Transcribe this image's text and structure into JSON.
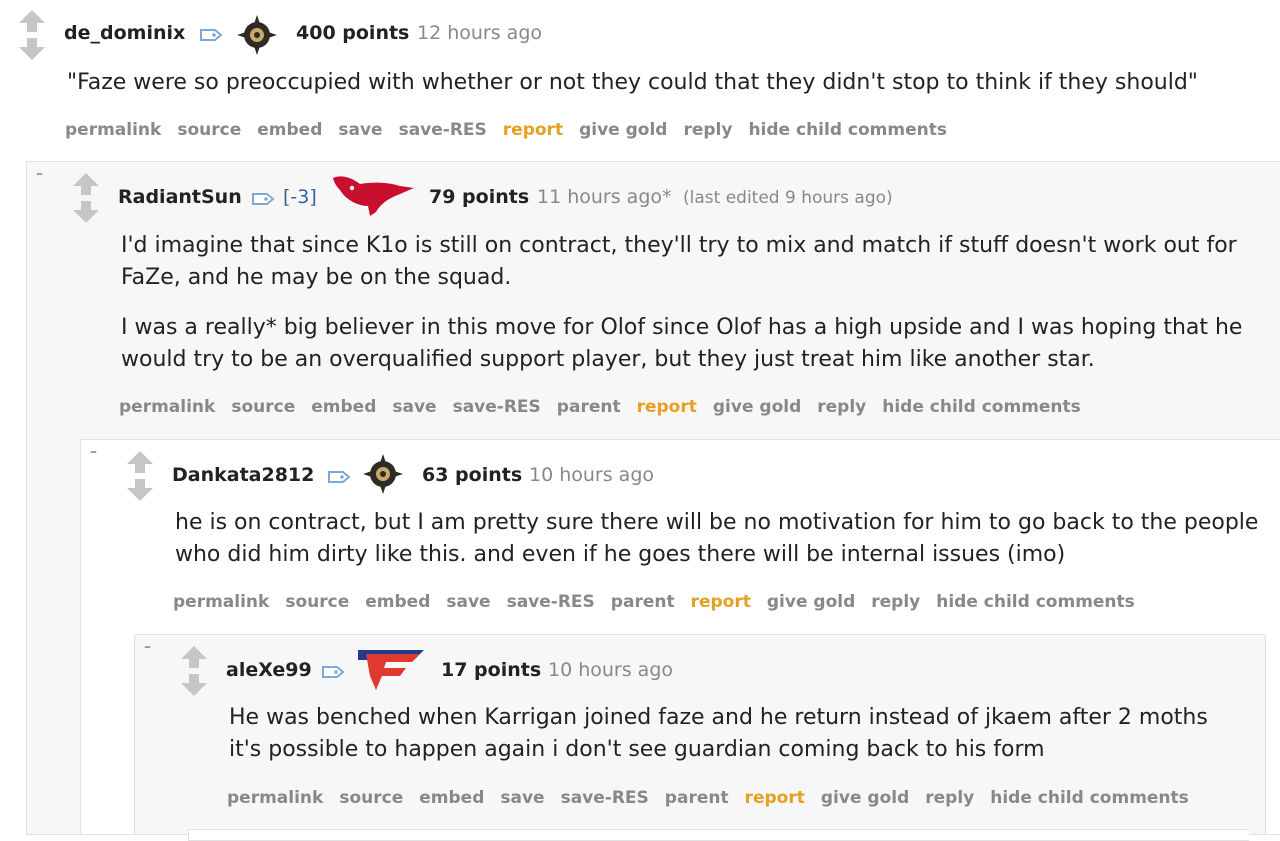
{
  "comments": [
    {
      "user": "de_dominix",
      "points": "400 points",
      "time": "12 hours ago",
      "text": "\"Faze were so preoccupied with whether or not they could that they didn't stop to think if they should\"",
      "actions": [
        "permalink",
        "source",
        "embed",
        "save",
        "save-RES",
        "report",
        "give gold",
        "reply",
        "hide child comments"
      ]
    },
    {
      "collapse": "–",
      "user": "RadiantSun",
      "score_tag": "[-3]",
      "points": "79 points",
      "time": "11 hours ago*",
      "edited": "(last edited 9 hours ago)",
      "paragraphs": [
        "I'd imagine that since K1o is still on contract, they'll try to mix and match if stuff doesn't work out for FaZe, and he may be on the squad.",
        "I was a really* big believer in this move for Olof since Olof has a high upside and I was hoping that he would try to be an overqualified support player, but they just treat him like another star."
      ],
      "actions": [
        "permalink",
        "source",
        "embed",
        "save",
        "save-RES",
        "parent",
        "report",
        "give gold",
        "reply",
        "hide child comments"
      ]
    },
    {
      "collapse": "–",
      "user": "Dankata2812",
      "points": "63 points",
      "time": "10 hours ago",
      "text": "he is on contract, but I am pretty sure there will be no motivation for him to go back to the people who did him dirty like this. and even if he goes there will be internal issues (imo)",
      "actions": [
        "permalink",
        "source",
        "embed",
        "save",
        "save-RES",
        "parent",
        "report",
        "give gold",
        "reply",
        "hide child comments"
      ]
    },
    {
      "collapse": "–",
      "user": "aleXe99",
      "points": "17 points",
      "time": "10 hours ago",
      "text": "He was benched when Karrigan joined faze and he return instead of jkaem after 2 moths it's possible to happen again i don't see guardian coming back to his form",
      "actions": [
        "permalink",
        "source",
        "embed",
        "save",
        "save-RES",
        "parent",
        "report",
        "give gold",
        "reply",
        "hide child comments"
      ]
    }
  ],
  "colors": {
    "report": "#e6a021",
    "muted": "#888888",
    "tag": "#336699",
    "box": "#f7f7f8"
  },
  "icons": [
    "upvote-arrow-icon",
    "downvote-arrow-icon",
    "user-tag-icon",
    "nip-flair-icon",
    "mousesports-flair-icon",
    "faze-flair-icon"
  ]
}
